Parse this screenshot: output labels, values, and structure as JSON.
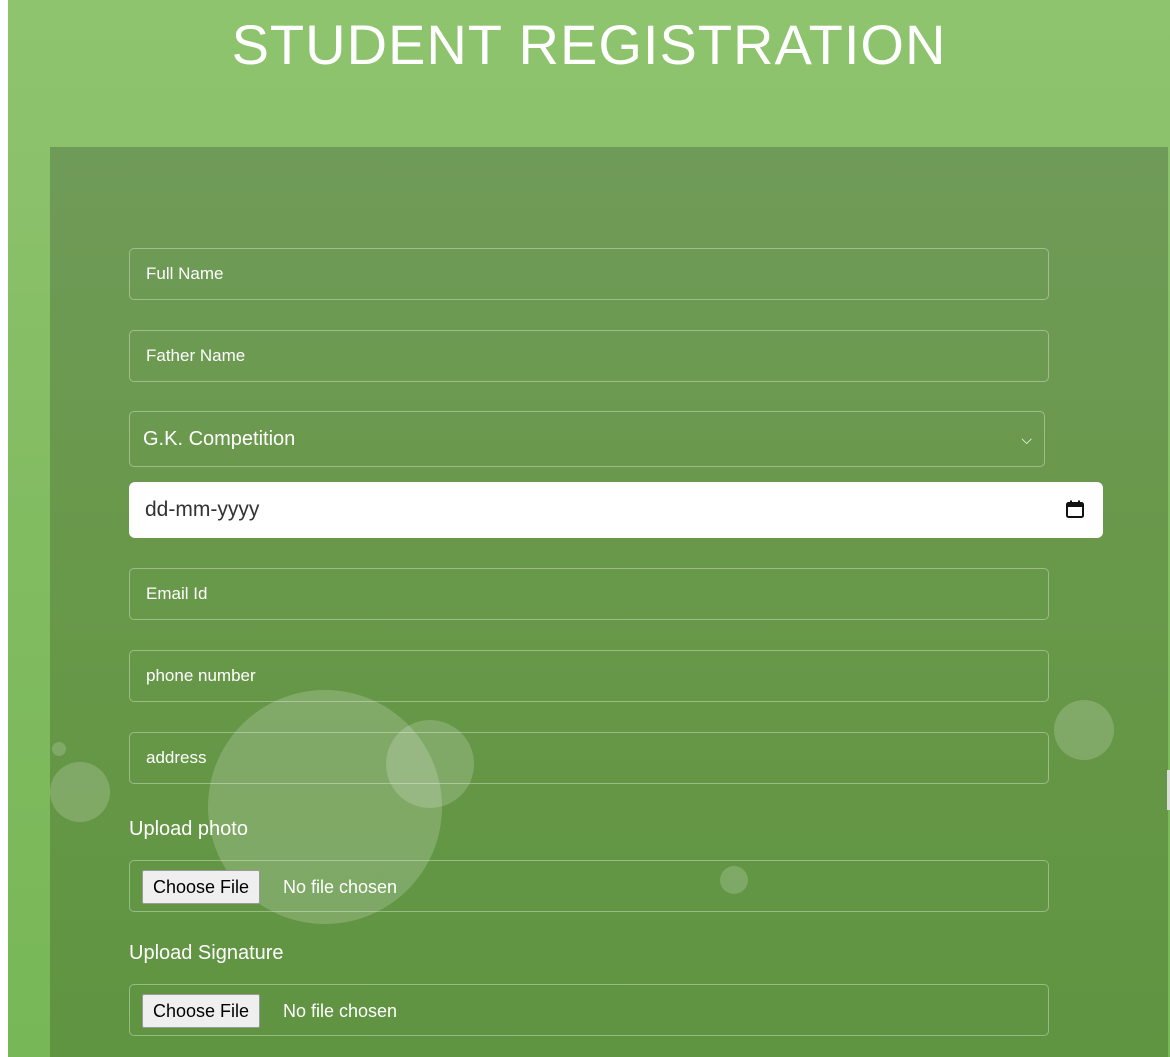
{
  "header": {
    "title": "STUDENT REGISTRATION"
  },
  "form": {
    "full_name_placeholder": "Full Name",
    "father_name_placeholder": "Father Name",
    "competition_select": {
      "selected": "G.K. Competition",
      "icon": "chevron-down-icon"
    },
    "dob_placeholder": "dd-mm-yyyy",
    "dob_icon": "calendar-icon",
    "email_placeholder": "Email Id",
    "phone_placeholder": "phone number",
    "address_placeholder": "address",
    "photo_upload": {
      "label": "Upload photo",
      "button_label": "Choose File",
      "status": "No file chosen"
    },
    "signature_upload": {
      "label": "Upload Signature",
      "button_label": "Choose File",
      "status": "No file chosen"
    }
  },
  "colors": {
    "page_background": "#8fc46f",
    "panel_background": "#689849",
    "text": "#ffffff"
  }
}
